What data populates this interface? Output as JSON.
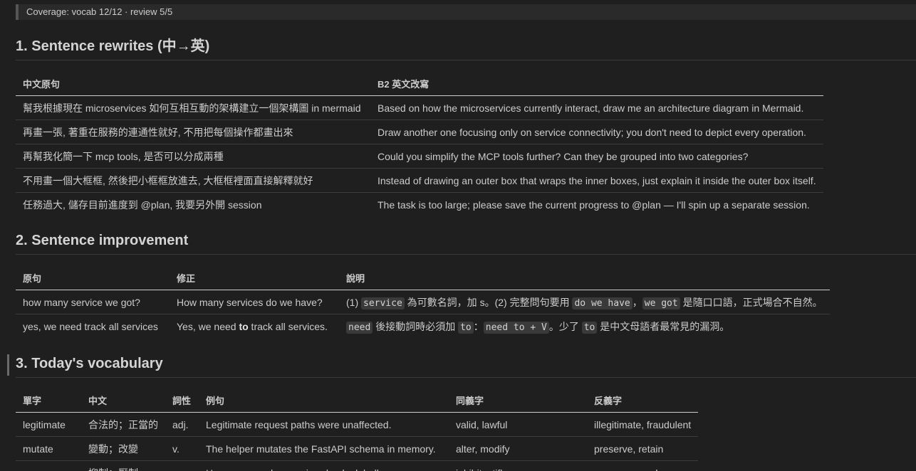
{
  "coverage": "Coverage: vocab 12/12 · review 5/5",
  "sections": {
    "rewrites": {
      "title": "1. Sentence rewrites (中→英)",
      "headers": [
        "中文原句",
        "B2 英文改寫"
      ],
      "rows": [
        [
          "幫我根據現在 microservices 如何互相互動的架構建立一個架構圖 in mermaid",
          "Based on how the microservices currently interact, draw me an architecture diagram in Mermaid."
        ],
        [
          "再畫一張, 著重在服務的連通性就好, 不用把每個操作都畫出來",
          "Draw another one focusing only on service connectivity; you don't need to depict every operation."
        ],
        [
          "再幫我化簡一下 mcp tools, 是否可以分成兩種",
          "Could you simplify the MCP tools further? Can they be grouped into two categories?"
        ],
        [
          "不用畫一個大框框, 然後把小框框放進去, 大框框裡面直接解釋就好",
          "Instead of drawing an outer box that wraps the inner boxes, just explain it inside the outer box itself."
        ],
        [
          "任務過大, 儲存目前進度到 @plan, 我要另外開 session",
          "The task is too large; please save the current progress to @plan — I'll spin up a separate session."
        ]
      ]
    },
    "improvement": {
      "title": "2. Sentence improvement",
      "headers": [
        "原句",
        "修正",
        "說明"
      ],
      "rows": [
        {
          "original": "how many service we got?",
          "fixed": "How many services do we have?",
          "note": {
            "p1": "(1) ",
            "c1": "service",
            "p2": " 為可數名詞，加 s。(2) 完整問句要用 ",
            "c2": "do we have",
            "p3": "，",
            "c3": "we got",
            "p4": " 是隨口口語，正式場合不自然。"
          }
        },
        {
          "original": "yes, we need track all services",
          "fixed_pre": "Yes, we need ",
          "fixed_bold": "to",
          "fixed_post": " track all services.",
          "note": {
            "c1": "need",
            "p1": " 後接動詞時必須加 ",
            "c2": "to",
            "p2": "：",
            "c3": "need to + V",
            "p3": "。少了 ",
            "c4": "to",
            "p4": " 是中文母語者最常見的漏洞。"
          }
        }
      ]
    },
    "vocabulary": {
      "title": "3. Today's vocabulary",
      "headers": [
        "單字",
        "中文",
        "詞性",
        "例句",
        "同義字",
        "反義字"
      ],
      "rows": [
        [
          "legitimate",
          "合法的；正當的",
          "adj.",
          "Legitimate request paths were unaffected.",
          "valid, lawful",
          "illegitimate, fraudulent"
        ],
        [
          "mutate",
          "變動；改變",
          "v.",
          "The helper mutates the FastAPI schema in memory.",
          "alter, modify",
          "preserve, retain"
        ],
        [
          "suppress",
          "抑制；壓制",
          "v.",
          "He suppressed one noisy check globally.",
          "inhibit, stifle",
          "encourage, release"
        ]
      ]
    }
  }
}
